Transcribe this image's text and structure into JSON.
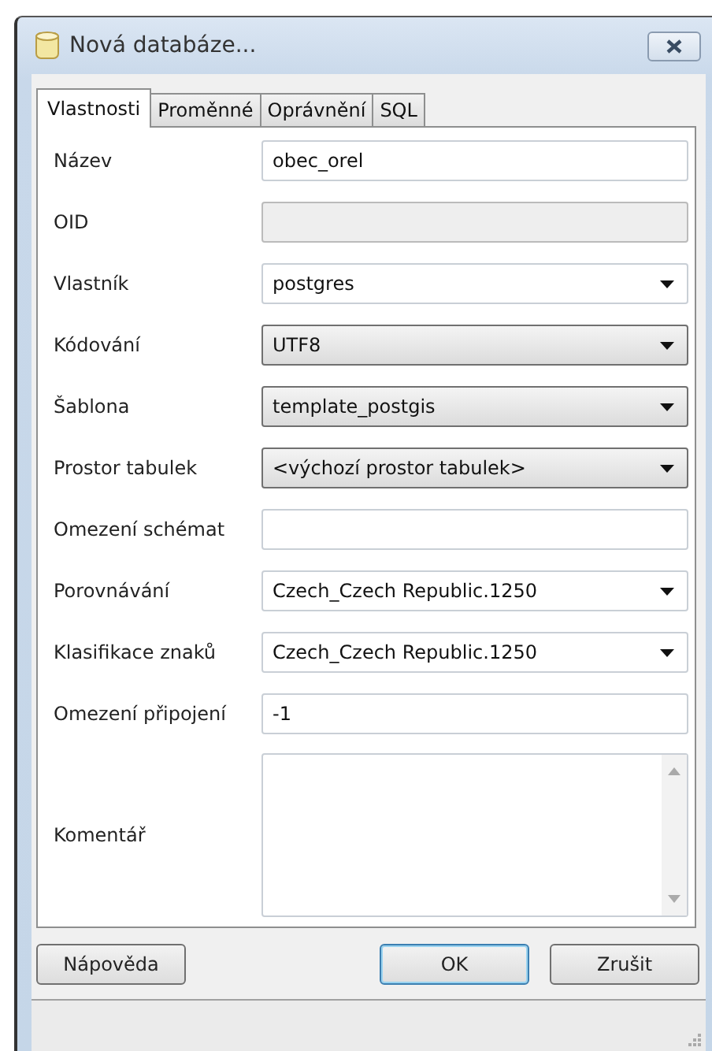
{
  "window": {
    "title": "Nová databáze..."
  },
  "tabs": [
    {
      "label": "Vlastnosti",
      "selected": true
    },
    {
      "label": "Proměnné",
      "selected": false
    },
    {
      "label": "Oprávnění",
      "selected": false
    },
    {
      "label": "SQL",
      "selected": false
    }
  ],
  "fields": [
    {
      "label": "Název",
      "kind": "text",
      "value": "obec_orel"
    },
    {
      "label": "OID",
      "kind": "readonly"
    },
    {
      "label": "Vlastník",
      "kind": "combo",
      "value": "postgres"
    },
    {
      "label": "Kódování",
      "kind": "select",
      "value": "UTF8"
    },
    {
      "label": "Šablona",
      "kind": "select",
      "value": "template_postgis"
    },
    {
      "label": "Prostor tabulek",
      "kind": "select",
      "value": "<výchozí prostor tabulek>"
    },
    {
      "label": "Omezení schémat",
      "kind": "text"
    },
    {
      "label": "Porovnávání",
      "kind": "combo",
      "value": "Czech_Czech Republic.1250"
    },
    {
      "label": "Klasifikace znaků",
      "kind": "combo",
      "value": "Czech_Czech Republic.1250"
    },
    {
      "label": "Omezení připojení",
      "kind": "text",
      "value": "-1"
    },
    {
      "label": "Komentář",
      "kind": "memo"
    }
  ],
  "buttons": [
    {
      "label": "Nápověda",
      "default": false
    },
    {
      "label": "OK",
      "default": true
    },
    {
      "label": "Zrušit",
      "default": false
    }
  ]
}
